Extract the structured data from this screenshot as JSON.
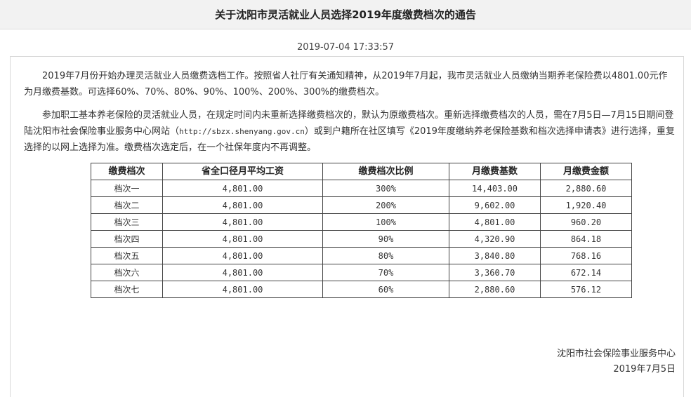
{
  "notice": {
    "title": "关于沈阳市灵活就业人员选择2019年度缴费档次的通告",
    "datetime": "2019-07-04 17:33:57",
    "paragraph1": "2019年7月份开始办理灵活就业人员缴费选档工作。按照省人社厅有关通知精神，从2019年7月起，我市灵活就业人员缴纳当期养老保险费以4801.00元作为月缴费基数。可选择60%、70%、80%、90%、100%、200%、300%的缴费档次。",
    "paragraph2_before_link": "参加职工基本养老保险的灵活就业人员，在规定时间内未重新选择缴费档次的，默认为原缴费档次。重新选择缴费档次的人员，需在7月5日—7月15日期间登陆沈阳市社会保险事业服务中心网站（",
    "paragraph2_link": "http://sbzx.shenyang.gov.cn",
    "paragraph2_after_link": "）或到户籍所在社区填写《2019年度缴纳养老保险基数和档次选择申请表》进行选择，重复选择的以网上选择为准。缴费档次选定后，在一个社保年度内不再调整。",
    "signature_org": "沈阳市社会保险事业服务中心",
    "signature_date": "2019年7月5日"
  },
  "table": {
    "headers": [
      "缴费档次",
      "省全口径月平均工资",
      "缴费档次比例",
      "月缴费基数",
      "月缴费金额"
    ],
    "rows": [
      [
        "档次一",
        "4,801.00",
        "300%",
        "14,403.00",
        "2,880.60"
      ],
      [
        "档次二",
        "4,801.00",
        "200%",
        "9,602.00",
        "1,920.40"
      ],
      [
        "档次三",
        "4,801.00",
        "100%",
        "4,801.00",
        "960.20"
      ],
      [
        "档次四",
        "4,801.00",
        "90%",
        "4,320.90",
        "864.18"
      ],
      [
        "档次五",
        "4,801.00",
        "80%",
        "3,840.80",
        "768.16"
      ],
      [
        "档次六",
        "4,801.00",
        "70%",
        "3,360.70",
        "672.14"
      ],
      [
        "档次七",
        "4,801.00",
        "60%",
        "2,880.60",
        "576.12"
      ]
    ]
  }
}
